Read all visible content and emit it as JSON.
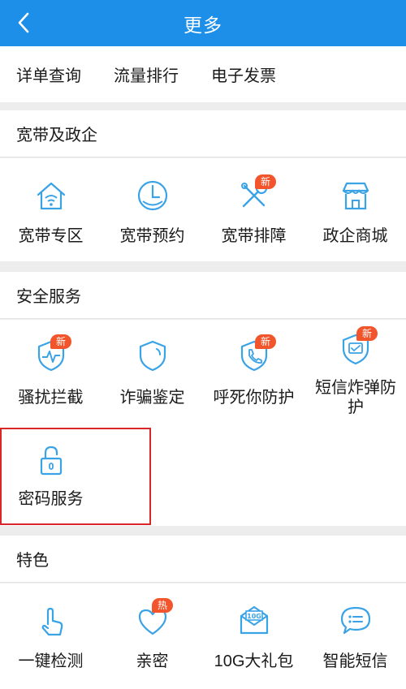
{
  "header": {
    "title": "更多"
  },
  "quick_links": [
    "详单查询",
    "流量排行",
    "电子发票"
  ],
  "sections": [
    {
      "title": "宽带及政企",
      "items": [
        {
          "label": "宽带专区",
          "icon": "home-wifi-icon"
        },
        {
          "label": "宽带预约",
          "icon": "clock-icon"
        },
        {
          "label": "宽带排障",
          "icon": "tools-icon",
          "badge": "新"
        },
        {
          "label": "政企商城",
          "icon": "store-icon"
        }
      ]
    },
    {
      "title": "安全服务",
      "items": [
        {
          "label": "骚扰拦截",
          "icon": "shield-pulse-icon",
          "badge": "新"
        },
        {
          "label": "诈骗鉴定",
          "icon": "shield-icon"
        },
        {
          "label": "呼死你防护",
          "icon": "shield-phone-icon",
          "badge": "新"
        },
        {
          "label": "短信炸弹防护",
          "icon": "shield-message-icon",
          "badge": "新"
        },
        {
          "label": "密码服务",
          "icon": "lock-icon"
        }
      ]
    },
    {
      "title": "特色",
      "items": [
        {
          "label": "一键检测",
          "icon": "tap-icon"
        },
        {
          "label": "亲密",
          "icon": "heart-icon",
          "badge": "热"
        },
        {
          "label": "10G大礼包",
          "icon": "envelope-10g-icon",
          "icon_text": "10G"
        },
        {
          "label": "智能短信",
          "icon": "chat-icon"
        }
      ]
    }
  ],
  "colors": {
    "header": "#1e8fe8",
    "icon": "#3aa3e6",
    "badge": "#f2552c",
    "highlight": "#d9262a"
  }
}
